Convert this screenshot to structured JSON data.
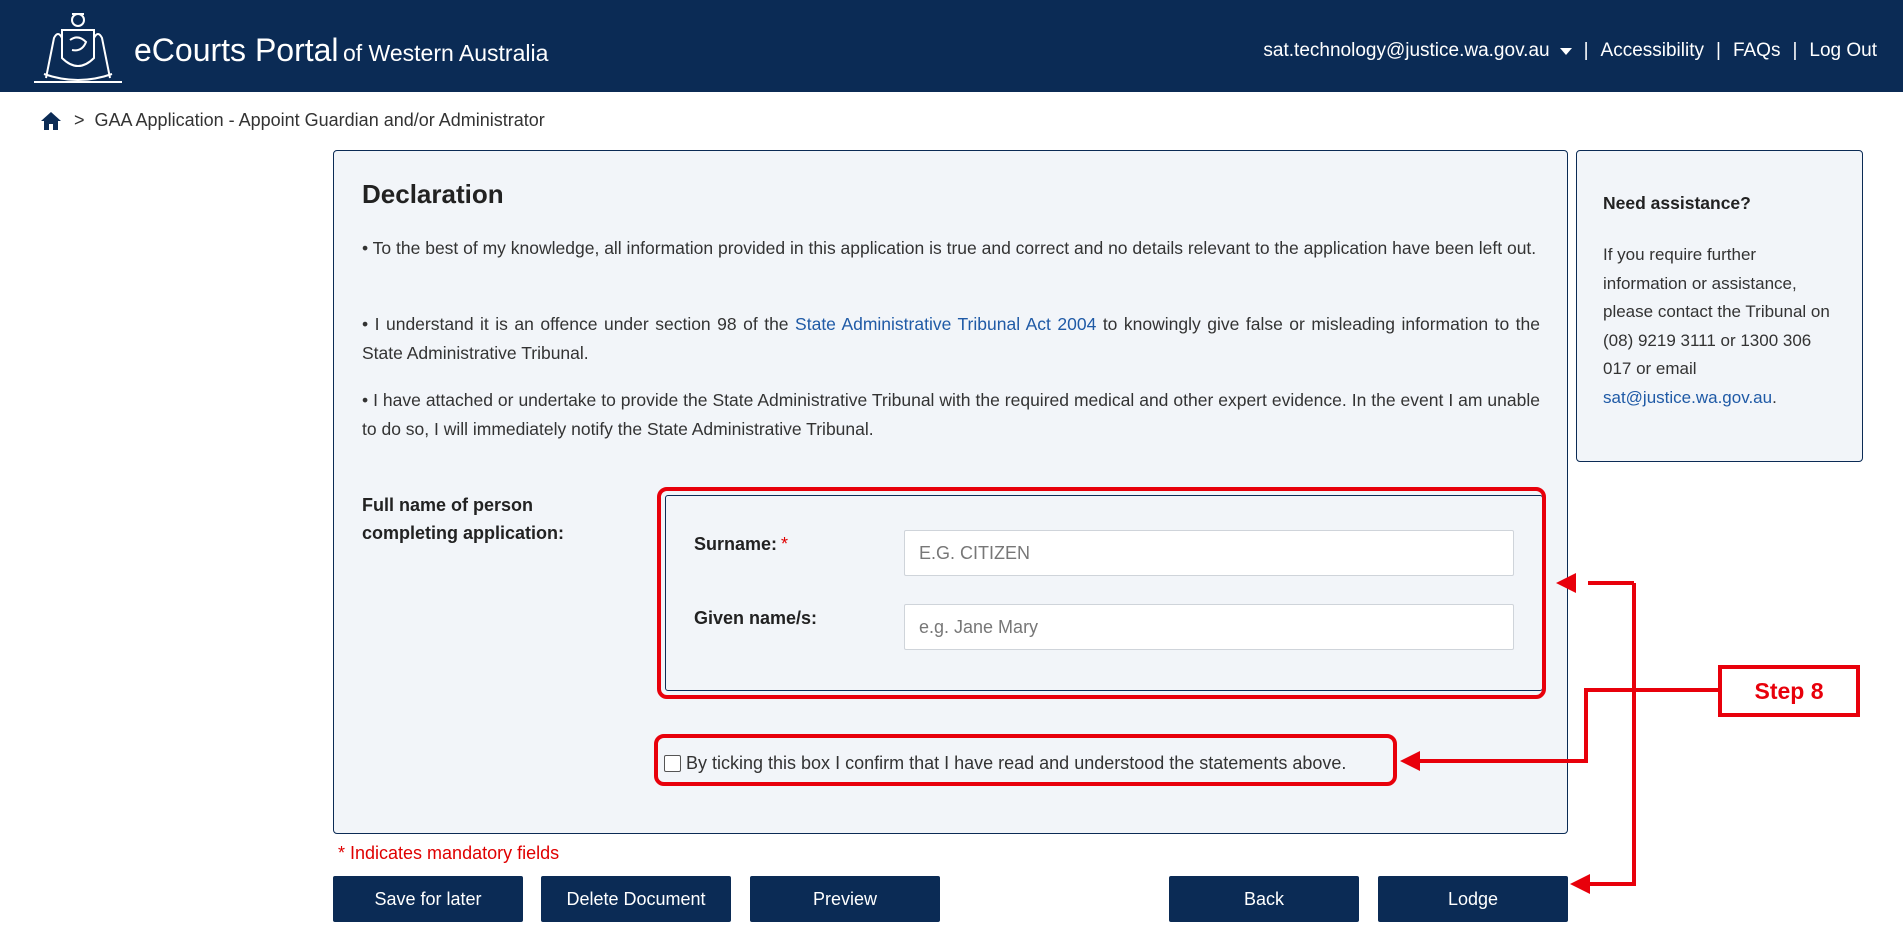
{
  "header": {
    "brand_main": "eCourts Portal",
    "brand_sub": "of Western Australia",
    "user_email": "sat.technology@justice.wa.gov.au",
    "nav": [
      "Accessibility",
      "FAQs",
      "Log Out"
    ],
    "bg_color": "#0b2b55"
  },
  "breadcrumb": {
    "home_icon": "home-icon",
    "separator": ">",
    "current": "GAA Application - Appoint Guardian and/or Administrator"
  },
  "declaration": {
    "title": "Declaration",
    "statements": [
      {
        "text": "• To the best of my knowledge, all information provided in this application is true and correct and no details relevant to the application have been left out."
      },
      {
        "prefix": "•  I understand it is an offence under section 98 of the ",
        "link": "State Administrative Tribunal Act 2004",
        "suffix": " to knowingly give false or misleading information to the State Administrative Tribunal."
      },
      {
        "text": "• I have attached or undertake to provide the State Administrative Tribunal with the required medical and other expert evidence. In the event I am unable to do so, I will immediately notify the State Administrative Tribunal."
      }
    ],
    "full_name_label": "Full name of person completing application:",
    "surname_label": "Surname:",
    "required_mark": "*",
    "surname_placeholder": "E.G. CITIZEN",
    "surname_value": "",
    "given_label": "Given name/s:",
    "given_placeholder": "e.g. Jane Mary",
    "given_value": "",
    "confirm_label": "By ticking this box I confirm that I have read and understood the statements above.",
    "confirm_checked": false
  },
  "assistance": {
    "title": "Need assistance?",
    "body": "If you require further information or assistance, please contact the Tribunal on (08) 9219 3111 or 1300 306 017 or email",
    "email": "sat@justice.wa.gov.au",
    "trailing": "."
  },
  "mandatory_note": "* Indicates mandatory fields",
  "buttons": {
    "save": "Save for later",
    "delete": "Delete Document",
    "preview": "Preview",
    "back": "Back",
    "lodge": "Lodge"
  },
  "annotation": {
    "step_label": "Step 8",
    "color": "#e8000b"
  }
}
